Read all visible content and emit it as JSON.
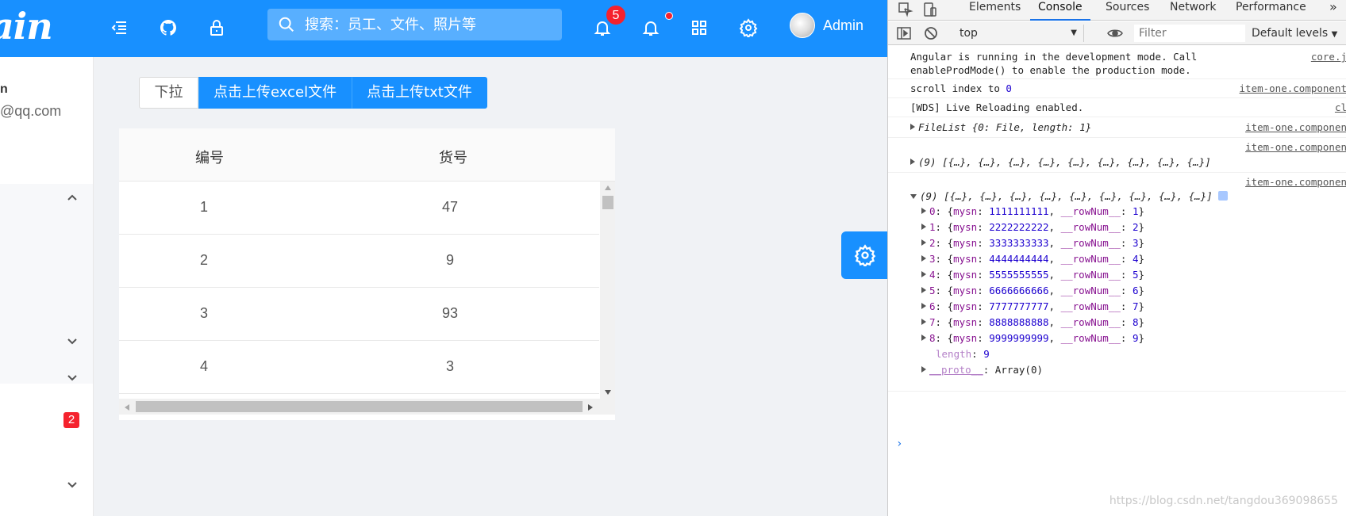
{
  "header": {
    "logo_text": "ain",
    "search_placeholder": "搜索：员工、文件、照片等",
    "notification_count": "5",
    "user_name": "Admin"
  },
  "sidebar": {
    "user_name_partial": "n",
    "email_partial": "@qq.com",
    "badge_count": "2"
  },
  "toolbar": {
    "dropdown_label": "下拉",
    "upload_excel_label": "点击上传excel文件",
    "upload_txt_label": "点击上传txt文件"
  },
  "table": {
    "columns": [
      "编号",
      "货号"
    ],
    "rows": [
      [
        "1",
        "47"
      ],
      [
        "2",
        "9"
      ],
      [
        "3",
        "93"
      ],
      [
        "4",
        "3"
      ]
    ]
  },
  "devtools": {
    "tabs": [
      "Elements",
      "Console",
      "Sources",
      "Network",
      "Performance"
    ],
    "more": "»",
    "context": "top",
    "filter_placeholder": "Filter",
    "levels": "Default levels",
    "messages": [
      {
        "text": "Angular is running in the development mode. Call",
        "text2": "enableProdMode() to enable the production mode.",
        "source": "core.j"
      },
      {
        "text_prefix": "scroll index to ",
        "text_num": "0",
        "source": "item-one.component"
      },
      {
        "text": "[WDS] Live Reloading enabled.",
        "source": "cl"
      },
      {
        "text": "FileList {0: File, length: 1}",
        "source": "item-one.componen"
      },
      {
        "text": "(9) [{…}, {…}, {…}, {…}, {…}, {…}, {…}, {…}, {…}]",
        "source": "item-one.componen"
      },
      {
        "text": "(9) [{…}, {…}, {…}, {…}, {…}, {…}, {…}, {…}, {…}]",
        "source": "item-one.componen"
      }
    ],
    "array_items": [
      {
        "index": "0",
        "mysn": "1111111111",
        "rownum": "1"
      },
      {
        "index": "1",
        "mysn": "2222222222",
        "rownum": "2"
      },
      {
        "index": "2",
        "mysn": "3333333333",
        "rownum": "3"
      },
      {
        "index": "3",
        "mysn": "4444444444",
        "rownum": "4"
      },
      {
        "index": "4",
        "mysn": "5555555555",
        "rownum": "5"
      },
      {
        "index": "5",
        "mysn": "6666666666",
        "rownum": "6"
      },
      {
        "index": "6",
        "mysn": "7777777777",
        "rownum": "7"
      },
      {
        "index": "7",
        "mysn": "8888888888",
        "rownum": "8"
      },
      {
        "index": "8",
        "mysn": "9999999999",
        "rownum": "9"
      }
    ],
    "length_label": "length",
    "length_value": "9",
    "proto_label": "__proto__",
    "proto_value": "Array(0)",
    "prompt": "›"
  },
  "watermark": "https://blog.csdn.net/tangdou369098655"
}
